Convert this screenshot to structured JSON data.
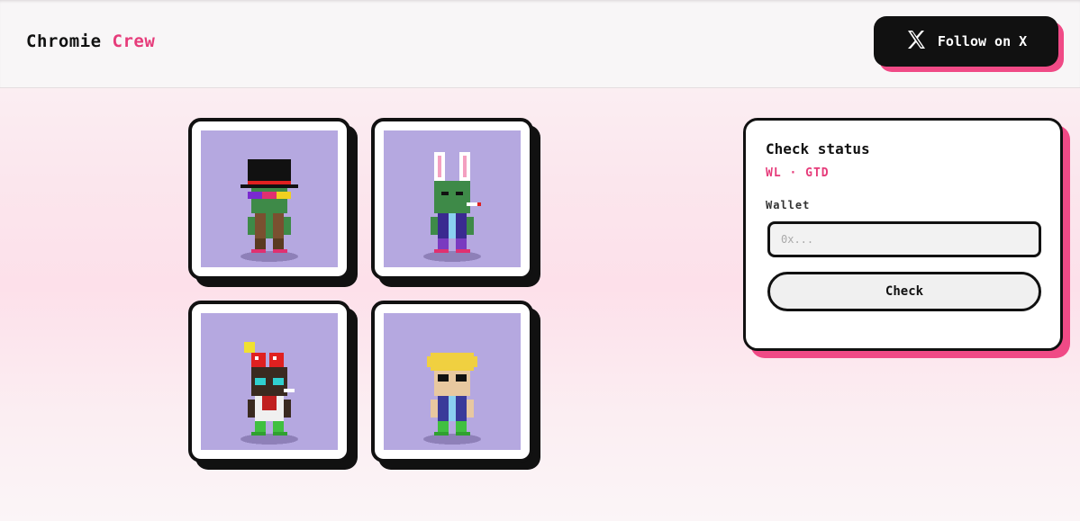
{
  "header": {
    "brand_first": "Chromie",
    "brand_second": "Crew",
    "follow_label": "Follow on X"
  },
  "gallery": {
    "items": [
      {
        "character": "top-hat-goggles"
      },
      {
        "character": "bunny-ears"
      },
      {
        "character": "cherry-bow"
      },
      {
        "character": "blond-hair"
      }
    ]
  },
  "status_panel": {
    "title": "Check status",
    "subtitle": "WL · GTD",
    "wallet_label": "Wallet",
    "wallet_value": "",
    "wallet_placeholder": "0x...",
    "check_label": "Check"
  },
  "colors": {
    "accent": "#e63b7a",
    "shadow_pink": "#f04a86",
    "art_bg": "#b5a8e0",
    "ink": "#111111"
  }
}
